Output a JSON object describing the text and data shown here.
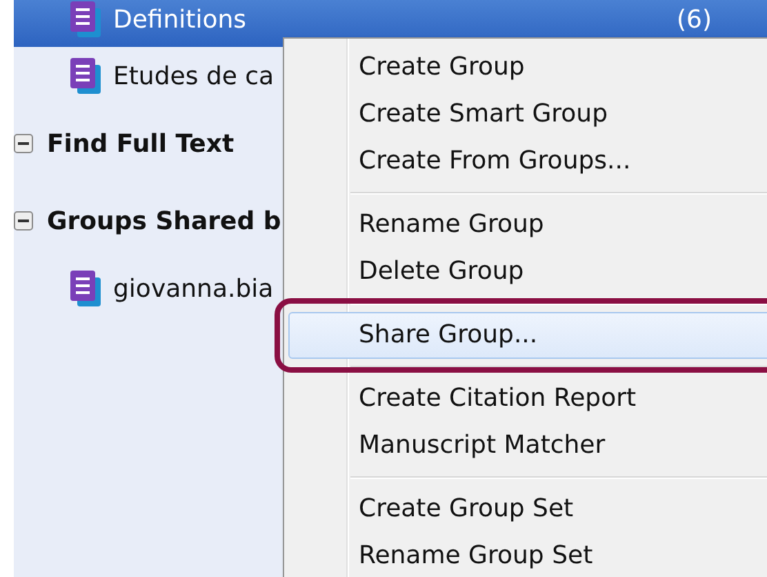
{
  "tree": [
    {
      "kind": "group",
      "label": "Definitions",
      "count": "(6)",
      "selected": true
    },
    {
      "kind": "group",
      "label": "Etudes de ca",
      "selected": false
    },
    {
      "kind": "section",
      "label": "Find Full Text",
      "expanded": true
    },
    {
      "kind": "section",
      "label": "Groups Shared b",
      "expanded": true,
      "children": [
        {
          "kind": "group",
          "label": "giovanna.bia",
          "selected": false
        }
      ]
    }
  ],
  "context_menu": [
    {
      "kind": "item",
      "label": "Create Group",
      "selected": false
    },
    {
      "kind": "item",
      "label": "Create Smart Group",
      "selected": false
    },
    {
      "kind": "item",
      "label": "Create From Groups...",
      "selected": false
    },
    {
      "kind": "separator"
    },
    {
      "kind": "item",
      "label": "Rename Group",
      "selected": false
    },
    {
      "kind": "item",
      "label": "Delete Group",
      "selected": false
    },
    {
      "kind": "separator"
    },
    {
      "kind": "item",
      "label": "Share Group...",
      "selected": true
    },
    {
      "kind": "separator"
    },
    {
      "kind": "item",
      "label": "Create Citation Report",
      "selected": false
    },
    {
      "kind": "item",
      "label": "Manuscript Matcher",
      "selected": false
    },
    {
      "kind": "separator"
    },
    {
      "kind": "item",
      "label": "Create Group Set",
      "selected": false
    },
    {
      "kind": "item",
      "label": "Rename Group Set",
      "selected": false
    }
  ]
}
